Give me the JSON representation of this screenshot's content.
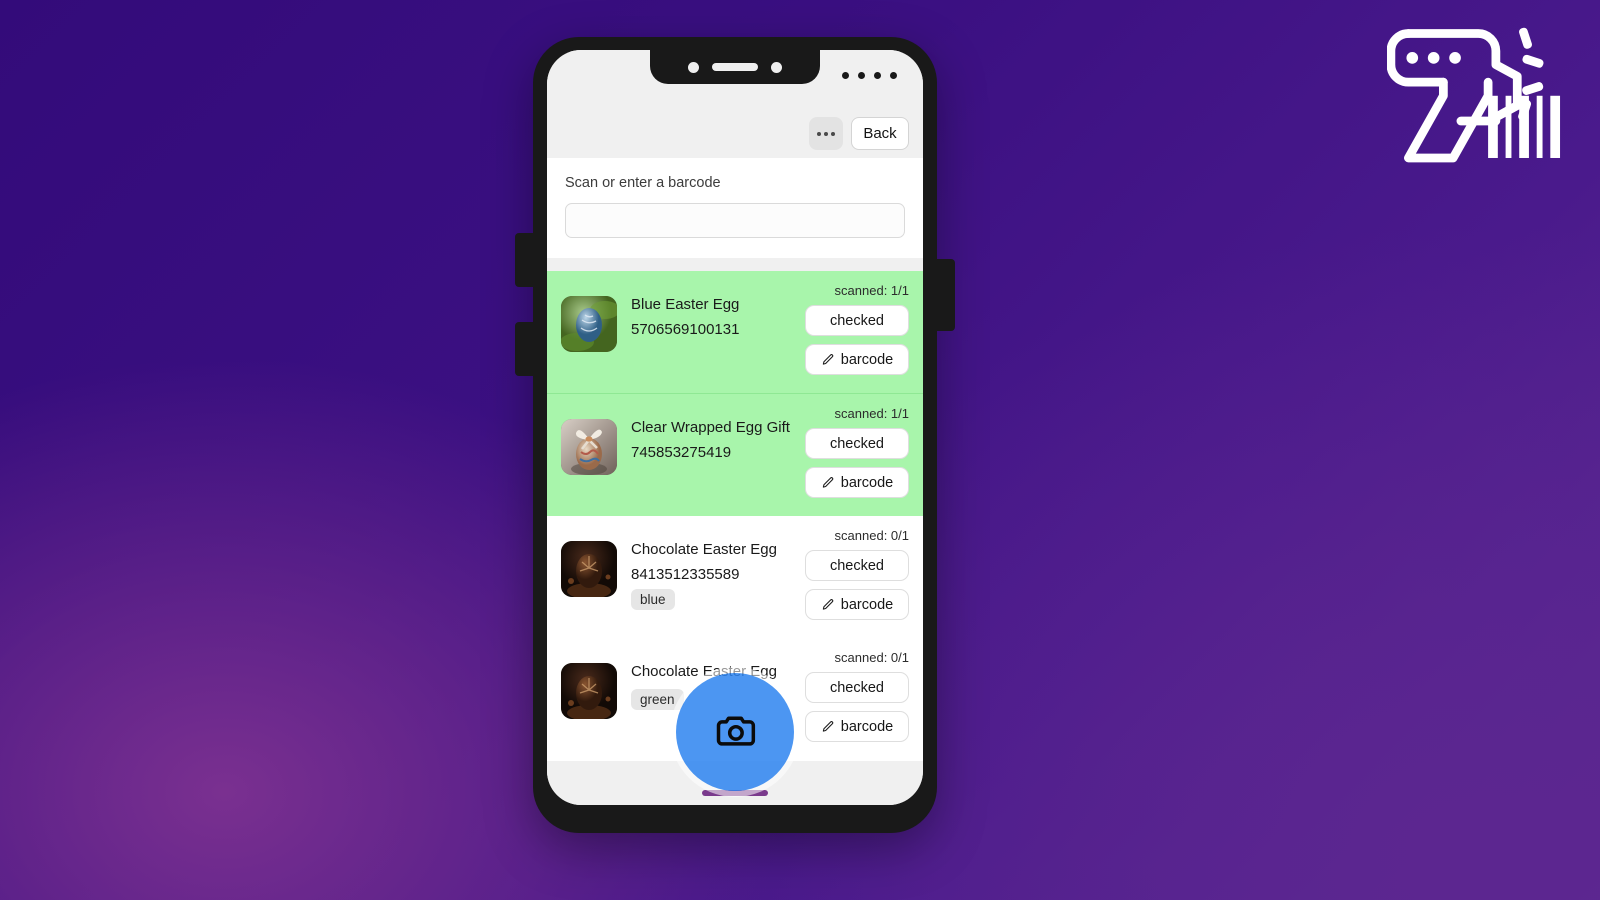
{
  "theme": {
    "bg_purple_dark": "#330b7a",
    "bg_purple_light": "#7a3090",
    "scanned_row_green": "#a8f5ab",
    "fab_blue": "#2e85f0",
    "phone_frame": "#191919"
  },
  "logo": {
    "name": "barcode-scanner-logo"
  },
  "topbar": {
    "more_label": "",
    "back_label": "Back"
  },
  "search": {
    "label": "Scan or enter a barcode",
    "value": "",
    "placeholder": ""
  },
  "actions": {
    "checked_label": "checked",
    "barcode_label": "barcode"
  },
  "items": [
    {
      "title": "Blue Easter Egg",
      "code": "5706569100131",
      "tag": "",
      "scanned": "scanned: 1/1",
      "is_scanned": true,
      "thumb": "blue-easter-egg-thumbnail"
    },
    {
      "title": "Clear Wrapped Egg Gift",
      "code": "745853275419",
      "tag": "",
      "scanned": "scanned: 1/1",
      "is_scanned": true,
      "thumb": "clear-wrapped-egg-gift-thumbnail"
    },
    {
      "title": "Chocolate Easter Egg",
      "code": "8413512335589",
      "tag": "blue",
      "scanned": "scanned: 0/1",
      "is_scanned": false,
      "thumb": "chocolate-easter-egg-thumbnail"
    },
    {
      "title": "Chocolate Easter Egg",
      "code": "",
      "tag": "green",
      "scanned": "scanned: 0/1",
      "is_scanned": false,
      "thumb": "chocolate-easter-egg-thumbnail"
    }
  ],
  "fab": {
    "icon": "camera-icon"
  }
}
